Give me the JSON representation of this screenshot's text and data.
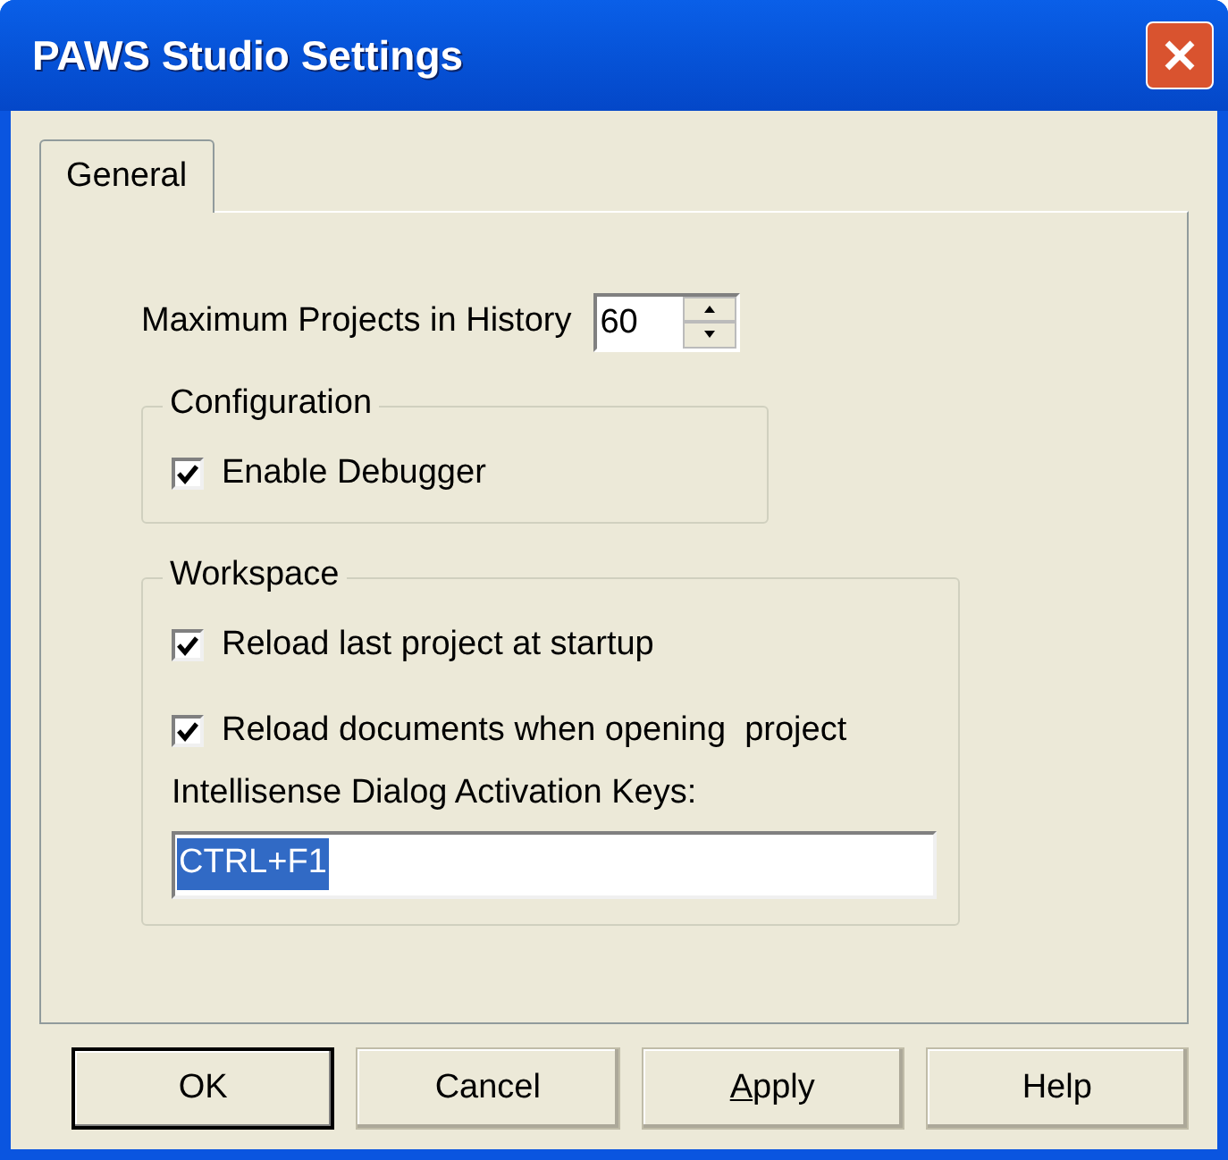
{
  "window": {
    "title": "PAWS Studio Settings"
  },
  "tabs": [
    {
      "label": "General",
      "selected": true
    }
  ],
  "max_projects": {
    "label": "Maximum Projects in History",
    "value": "60"
  },
  "groups": [
    {
      "title": "Configuration",
      "checkboxes": [
        {
          "label": "Enable Debugger",
          "checked": true
        }
      ]
    },
    {
      "title": "Workspace",
      "checkboxes": [
        {
          "label": "Reload last project at startup",
          "checked": true
        },
        {
          "label": "Reload documents when opening  project",
          "checked": true
        }
      ],
      "field": {
        "label": "Intellisense Dialog Activation Keys:",
        "value": "CTRL+F1",
        "selected": true
      }
    }
  ],
  "buttons": [
    {
      "label": "OK",
      "default": true
    },
    {
      "label": "Cancel",
      "default": false
    },
    {
      "label": "Apply",
      "default": false,
      "underline_first_letter": true
    },
    {
      "label": "Help",
      "default": false
    }
  ]
}
